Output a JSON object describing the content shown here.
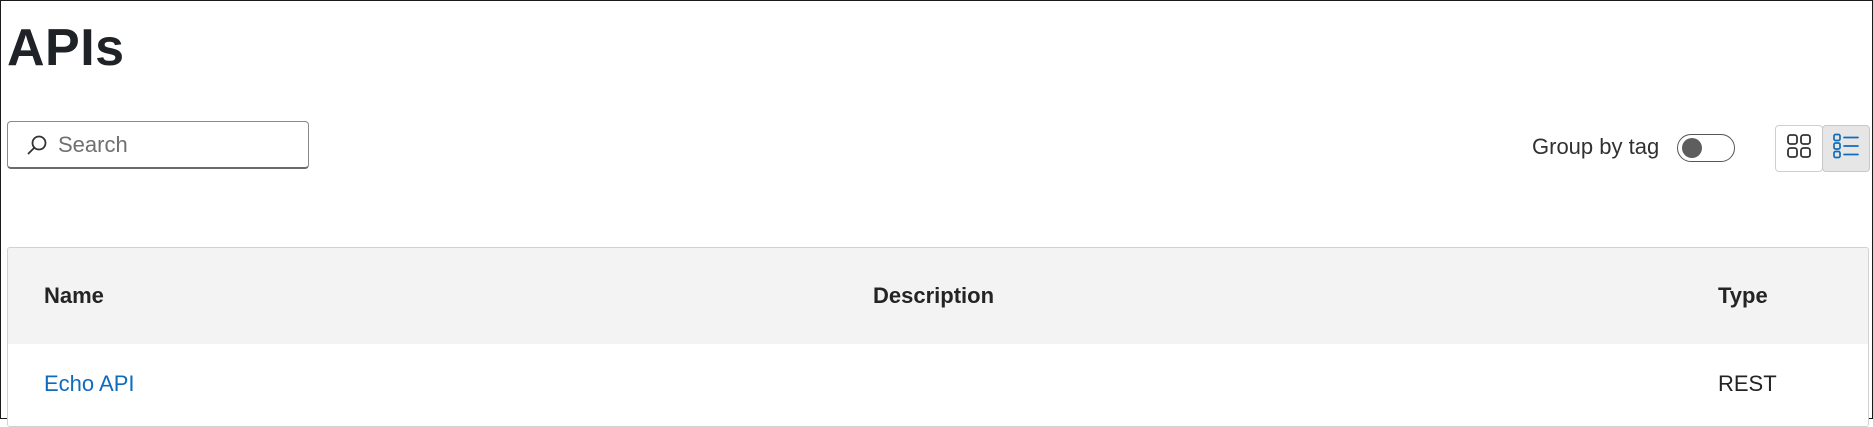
{
  "page": {
    "title": "APIs"
  },
  "search": {
    "placeholder": "Search",
    "value": ""
  },
  "group_by_tag": {
    "label": "Group by tag",
    "enabled": false
  },
  "view_mode": {
    "options": [
      "grid-icon",
      "list-icon"
    ],
    "selected": "list"
  },
  "table": {
    "columns": [
      "Name",
      "Description",
      "Type"
    ],
    "rows": [
      {
        "name": "Echo API",
        "description": "",
        "type": "REST"
      }
    ]
  },
  "colors": {
    "link": "#0f6cbd",
    "header_bg": "#f3f3f3",
    "selected_view_bg": "#e6e6e6"
  }
}
